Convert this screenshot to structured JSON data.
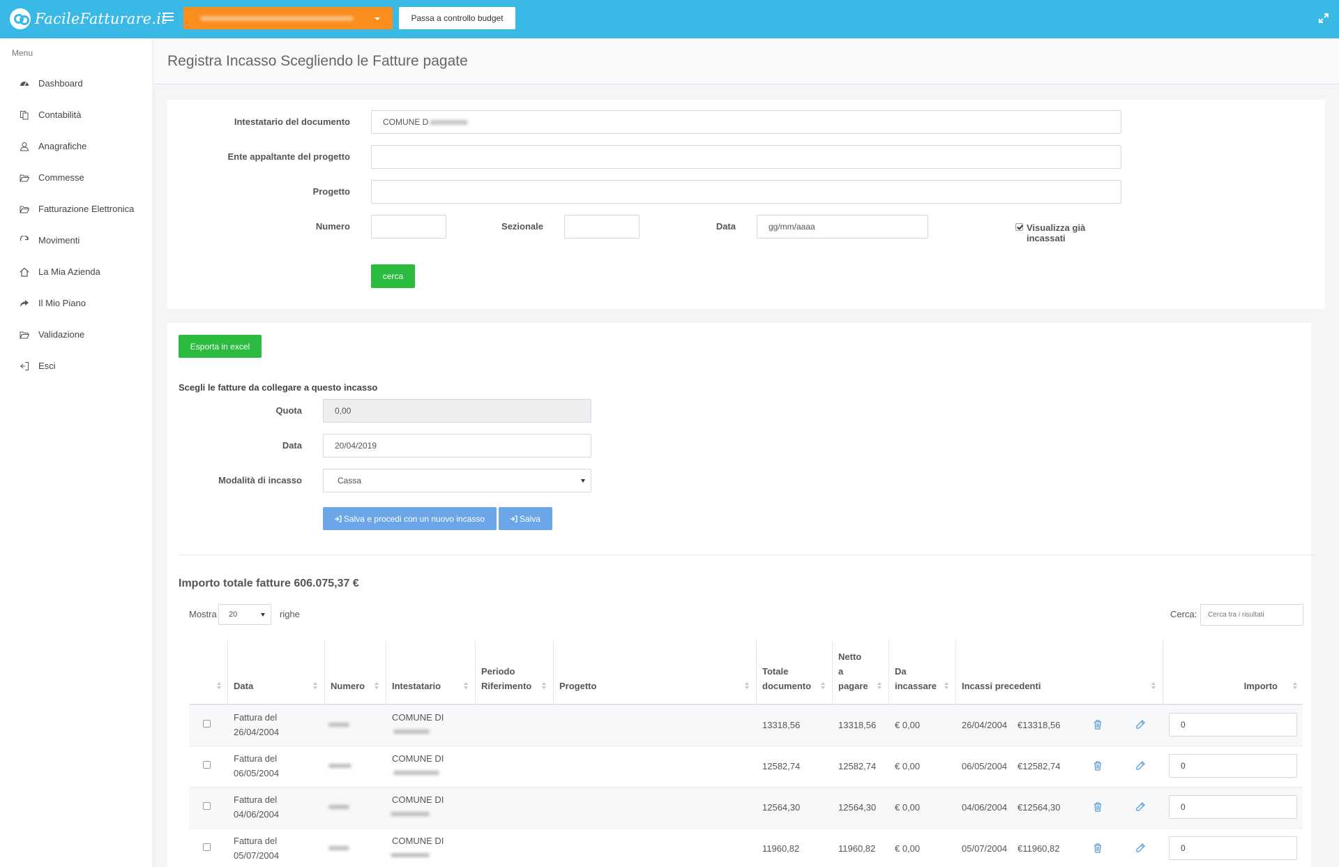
{
  "app": {
    "brand": "FacileFatturare.it",
    "budget_button": "Passa a controllo budget"
  },
  "sidebar": {
    "caption": "Menu",
    "items": [
      {
        "label": "Dashboard",
        "icon": "dashboard-icon"
      },
      {
        "label": "Contabilità",
        "icon": "copy-icon"
      },
      {
        "label": "Anagrafiche",
        "icon": "user-icon"
      },
      {
        "label": "Commesse",
        "icon": "folder-open-icon"
      },
      {
        "label": "Fatturazione Elettronica",
        "icon": "folder-open-icon"
      },
      {
        "label": "Movimenti",
        "icon": "refresh-icon"
      },
      {
        "label": "La Mia Azienda",
        "icon": "home-icon"
      },
      {
        "label": "Il Mio Piano",
        "icon": "share-icon"
      },
      {
        "label": "Validazione",
        "icon": "folder-open-icon"
      },
      {
        "label": "Esci",
        "icon": "sign-out-icon"
      }
    ]
  },
  "main": {
    "title": "Registra Incasso Scegliendo le Fatture pagate",
    "search_form": {
      "intestatario_label": "Intestatario del documento",
      "intestatario_value": "COMUNE D",
      "ente_label": "Ente appaltante del progetto",
      "progetto_label": "Progetto",
      "numero_label": "Numero",
      "sezionale_label": "Sezionale",
      "data_label": "Data",
      "data_placeholder": "gg/mm/aaaa",
      "visualizza_label": "Visualizza già incassati",
      "search_button": "cerca"
    },
    "incasso_form": {
      "export_button": "Esporta in excel",
      "heading": "Scegli le fatture da collegare a questo incasso",
      "quota_label": "Quota",
      "quota_value": "0,00",
      "data_label": "Data",
      "data_value": "20/04/2019",
      "modalita_label": "Modalità di incasso",
      "modalita_value": "Cassa",
      "save_new_button": "Salva e procedi con un nuovo incasso",
      "save_button": "Salva"
    },
    "total_label": "Importo totale fatture 606.075,37 €",
    "table_controls": {
      "show_label": "Mostra",
      "page_size": "20",
      "rows_label": "righe",
      "search_label": "Cerca:",
      "search_placeholder": "Cerca tra i risultati"
    },
    "table": {
      "headers": {
        "data": "Data",
        "numero": "Numero",
        "intestatario": "Intestatario",
        "periodo_1": "Periodo",
        "periodo_2": "Riferimento",
        "progetto": "Progetto",
        "totale_1": "Totale",
        "totale_2": "documento",
        "netto_1": "Netto",
        "netto_2": "a",
        "netto_3": "pagare",
        "da_1": "Da",
        "da_2": "incassare",
        "incassi": "Incassi precedenti",
        "importo": "Importo"
      },
      "rows": [
        {
          "data_1": "Fattura del",
          "data_2": "26/04/2004",
          "intestatario": "COMUNE DI",
          "totale": "13318,56",
          "netto": "13318,56",
          "da_incassare": "€ 0,00",
          "prev_date": "26/04/2004",
          "prev_amount": "€13318,56",
          "importo": "0"
        },
        {
          "data_1": "Fattura del",
          "data_2": "06/05/2004",
          "intestatario": "COMUNE DI",
          "totale": "12582,74",
          "netto": "12582,74",
          "da_incassare": "€ 0,00",
          "prev_date": "06/05/2004",
          "prev_amount": "€12582,74",
          "importo": "0"
        },
        {
          "data_1": "Fattura del",
          "data_2": "04/06/2004",
          "intestatario": "COMUNE DI",
          "totale": "12564,30",
          "netto": "12564,30",
          "da_incassare": "€ 0,00",
          "prev_date": "04/06/2004",
          "prev_amount": "€12564,30",
          "importo": "0"
        },
        {
          "data_1": "Fattura del",
          "data_2": "05/07/2004",
          "intestatario": "COMUNE DI",
          "totale": "11960,82",
          "netto": "11960,82",
          "da_incassare": "€ 0,00",
          "prev_date": "05/07/2004",
          "prev_amount": "€11960,82",
          "importo": "0"
        }
      ]
    }
  },
  "colors": {
    "topbar": "#3ab9e7",
    "company_select": "#f98e1f",
    "green_button": "#2bbb3f",
    "blue_button": "#6ba7e8",
    "icon_blue": "#5b9bd5"
  }
}
